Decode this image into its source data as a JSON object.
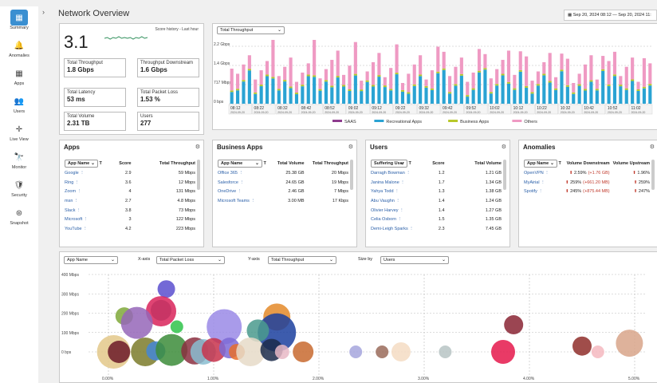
{
  "nav": [
    {
      "label": "Summary",
      "icon": "▦"
    },
    {
      "label": "Anomalies",
      "icon": "🔔"
    },
    {
      "label": "Apps",
      "icon": "▦"
    },
    {
      "label": "Users",
      "icon": "👥"
    },
    {
      "label": "Live View",
      "icon": "✛"
    },
    {
      "label": "Monitor",
      "icon": "🔭"
    },
    {
      "label": "Security",
      "icon": "🛡"
    },
    {
      "label": "Snapshot",
      "icon": "⊛"
    }
  ],
  "page_title": "Network Overview",
  "date_range": "Sep 20, 2024 08:12 — Sep 20, 2024 11:",
  "score": {
    "value": "3.1",
    "history_label": "Score history - Last hour"
  },
  "stats": [
    {
      "label": "Total Throughput",
      "value": "1.8 Gbps"
    },
    {
      "label": "Throughput Downstream",
      "value": "1.6 Gbps"
    },
    {
      "label": "Total Latency",
      "value": "53 ms"
    },
    {
      "label": "Total Packet Loss",
      "value": "1.53 %"
    },
    {
      "label": "Total Volume",
      "value": "2.31 TB"
    },
    {
      "label": "Users",
      "value": "277"
    }
  ],
  "throughput": {
    "selector": "Total Throughput",
    "yticks": [
      "2.2 Gbps",
      "1.4 Gbps",
      "717 Mbps",
      "0 bps"
    ],
    "xticks": [
      "08:12",
      "08:22",
      "08:32",
      "08:42",
      "08:52",
      "09:02",
      "09:12",
      "09:22",
      "09:32",
      "09:42",
      "09:52",
      "10:02",
      "10:12",
      "10:22",
      "10:32",
      "10:42",
      "10:52",
      "11:02"
    ],
    "date_sub": "2024-09-20",
    "legend": [
      {
        "name": "SAAS",
        "color": "#8e3b8e"
      },
      {
        "name": "Recreational Apps",
        "color": "#2aa3d3"
      },
      {
        "name": "Business Apps",
        "color": "#b8c82a"
      },
      {
        "name": "Others",
        "color": "#ef9ac3"
      }
    ]
  },
  "apps": {
    "title": "Apps",
    "filter": "App Name",
    "cols": [
      "Score",
      "Total Throughput"
    ],
    "rows": [
      [
        "Google",
        "2.9",
        "59 Mbps"
      ],
      [
        "Ring",
        "3.6",
        "12 Mbps"
      ],
      [
        "Zoom",
        "4",
        "131 Mbps"
      ],
      [
        "msn",
        "2.7",
        "4.8 Mbps"
      ],
      [
        "Slack",
        "3.8",
        "73 Mbps"
      ],
      [
        "Microsoft",
        "3",
        "122 Mbps"
      ],
      [
        "YouTube",
        "4.2",
        "223 Mbps"
      ]
    ]
  },
  "business": {
    "title": "Business Apps",
    "filter": "App Name",
    "cols": [
      "Total Volume",
      "Total Throughput"
    ],
    "rows": [
      [
        "Office 365",
        "25.38 GB",
        "20 Mbps"
      ],
      [
        "Salesforce",
        "24.65 GB",
        "19 Mbps"
      ],
      [
        "OneDrive",
        "2.46 GB",
        "7 Mbps"
      ],
      [
        "Microsoft Teams",
        "3.00 MB",
        "17 Kbps"
      ]
    ]
  },
  "users": {
    "title": "Users",
    "filter": "Suffering User",
    "cols": [
      "Score",
      "Total Volume"
    ],
    "rows": [
      [
        "Darragh Bowman",
        "1.2",
        "1.21 GB"
      ],
      [
        "Janina Malone",
        "1.7",
        "1.34 GB"
      ],
      [
        "Yahya Todd",
        "1.3",
        "1.38 GB"
      ],
      [
        "Abu Vaughn",
        "1.4",
        "1.24 GB"
      ],
      [
        "Olivier Harvey",
        "1.4",
        "1.27 GB"
      ],
      [
        "Celia Osborn",
        "1.5",
        "1.35 GB"
      ],
      [
        "Demi-Leigh Sparks",
        "2.3",
        "7.45 GB"
      ]
    ]
  },
  "anomalies": {
    "title": "Anomalies",
    "filter": "App Name",
    "cols": [
      "Volume Downstream",
      "Volume Upstream"
    ],
    "rows": [
      [
        "OpenVPN",
        "2.59%",
        "(+1.76 GB)",
        "1.96%"
      ],
      [
        "MyAirial",
        "259%",
        "(+661.20 MB)",
        "259%"
      ],
      [
        "Spotify",
        "245%",
        "(+875.44 MB)",
        "247%"
      ]
    ]
  },
  "bubble": {
    "group_by": "App Name",
    "xaxis_label": "X-axis",
    "xaxis": "Total Packet Loss",
    "yaxis_label": "Y-axis",
    "yaxis": "Total Throughput",
    "size_label": "Size by",
    "size": "Users",
    "yticks": [
      "400 Mbps",
      "300 Mbps",
      "200 Mbps",
      "100 Mbps",
      "0 bps"
    ],
    "xticks": [
      "0.00%",
      "1.00%",
      "2.00%",
      "3.00%",
      "4.00%",
      "5.00%"
    ]
  },
  "chart_data": {
    "type": "scatter",
    "xlabel": "Total Packet Loss",
    "ylabel": "Total Throughput",
    "xlim": [
      0,
      5
    ],
    "ylim": [
      0,
      400
    ],
    "points": [
      {
        "x": 0.55,
        "y": 325,
        "r": 11,
        "c": "#5b4fcf"
      },
      {
        "x": 0.5,
        "y": 210,
        "r": 19,
        "c": "#d9235b"
      },
      {
        "x": 0.5,
        "y": 215,
        "r": 13,
        "c": "#c43363"
      },
      {
        "x": 0.15,
        "y": 185,
        "r": 11,
        "c": "#7fa83a"
      },
      {
        "x": 0.27,
        "y": 150,
        "r": 20,
        "c": "#9566b8"
      },
      {
        "x": 0.65,
        "y": 130,
        "r": 8,
        "c": "#2fc34a"
      },
      {
        "x": 1.1,
        "y": 130,
        "r": 22,
        "c": "#9a8ae6"
      },
      {
        "x": 1.6,
        "y": 180,
        "r": 17,
        "c": "#e48a29"
      },
      {
        "x": 1.6,
        "y": 100,
        "r": 24,
        "c": "#1b3f9f"
      },
      {
        "x": 1.42,
        "y": 110,
        "r": 14,
        "c": "#4a9a8d"
      },
      {
        "x": 0.05,
        "y": 0,
        "r": 21,
        "c": "#e3c88a"
      },
      {
        "x": 0.1,
        "y": 0,
        "r": 14,
        "c": "#6b1a28"
      },
      {
        "x": 0.35,
        "y": 0,
        "r": 18,
        "c": "#7b7b2a"
      },
      {
        "x": 0.45,
        "y": 5,
        "r": 12,
        "c": "#4487d6"
      },
      {
        "x": 0.6,
        "y": 10,
        "r": 20,
        "c": "#3c8c3a"
      },
      {
        "x": 0.82,
        "y": 5,
        "r": 17,
        "c": "#8b2f3f"
      },
      {
        "x": 0.9,
        "y": 0,
        "r": 16,
        "c": "#8abdd0"
      },
      {
        "x": 1.0,
        "y": 10,
        "r": 15,
        "c": "#c8324b"
      },
      {
        "x": 1.15,
        "y": 20,
        "r": 13,
        "c": "#7c6ad6"
      },
      {
        "x": 1.22,
        "y": 0,
        "r": 10,
        "c": "#e76f2a"
      },
      {
        "x": 1.35,
        "y": 0,
        "r": 18,
        "c": "#e6dbc8"
      },
      {
        "x": 1.55,
        "y": 10,
        "r": 14,
        "c": "#1b2a4a"
      },
      {
        "x": 1.65,
        "y": 0,
        "r": 9,
        "c": "#e8b8c6"
      },
      {
        "x": 1.85,
        "y": 0,
        "r": 13,
        "c": "#c86a2f"
      },
      {
        "x": 2.35,
        "y": 0,
        "r": 8,
        "c": "#a6a6dd"
      },
      {
        "x": 2.6,
        "y": 0,
        "r": 8,
        "c": "#9a6b5a"
      },
      {
        "x": 2.78,
        "y": 0,
        "r": 12,
        "c": "#f4dcc3"
      },
      {
        "x": 3.2,
        "y": 0,
        "r": 8,
        "c": "#b7c4c4"
      },
      {
        "x": 3.75,
        "y": 0,
        "r": 15,
        "c": "#e5184b"
      },
      {
        "x": 3.85,
        "y": 140,
        "r": 12,
        "c": "#8a2434"
      },
      {
        "x": 4.5,
        "y": 30,
        "r": 12,
        "c": "#8f2e2a"
      },
      {
        "x": 4.65,
        "y": 0,
        "r": 8,
        "c": "#f4b8c0"
      },
      {
        "x": 4.95,
        "y": 45,
        "r": 17,
        "c": "#d8a58a"
      }
    ]
  }
}
